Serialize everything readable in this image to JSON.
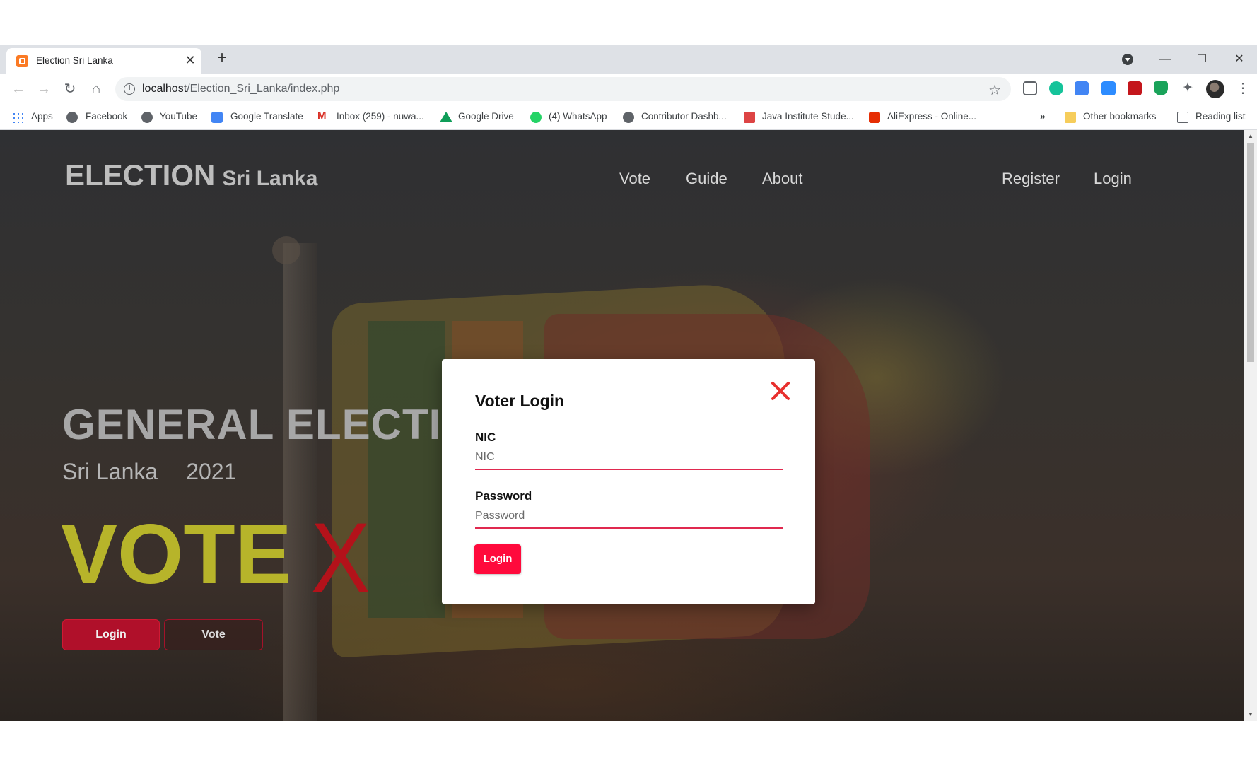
{
  "browser": {
    "tab_title": "Election Sri Lanka",
    "url_host": "localhost",
    "url_path": "/Election_Sri_Lanka/index.php",
    "bookmarks": [
      {
        "label": "Apps"
      },
      {
        "label": "Facebook"
      },
      {
        "label": "YouTube"
      },
      {
        "label": "Google Translate"
      },
      {
        "label": "Inbox (259) - nuwa..."
      },
      {
        "label": "Google Drive"
      },
      {
        "label": "(4) WhatsApp"
      },
      {
        "label": "Contributor Dashb..."
      },
      {
        "label": "Java Institute Stude..."
      },
      {
        "label": "AliExpress - Online..."
      }
    ],
    "overflow_label": "»",
    "other_bookmarks": "Other bookmarks",
    "reading_list": "Reading list"
  },
  "site": {
    "brand_main": "ELECTION",
    "brand_sub": "Sri Lanka",
    "nav": [
      {
        "label": "Vote"
      },
      {
        "label": "Guide"
      },
      {
        "label": "About"
      }
    ],
    "register_label": "Register",
    "login_label": "Login"
  },
  "hero": {
    "title": "GENERAL ELECTION",
    "country": "Sri Lanka",
    "year": "2021",
    "vote_word": "VOTE",
    "vote_mark": "X",
    "login_button": "Login",
    "vote_button": "Vote"
  },
  "modal": {
    "title": "Voter Login",
    "nic_label": "NIC",
    "nic_placeholder": "NIC",
    "password_label": "Password",
    "password_placeholder": "Password",
    "submit_label": "Login"
  },
  "colors": {
    "accent_red": "#ff0a3c",
    "vote_yellow": "#b7b42a",
    "vote_x_red": "#b3121a"
  }
}
